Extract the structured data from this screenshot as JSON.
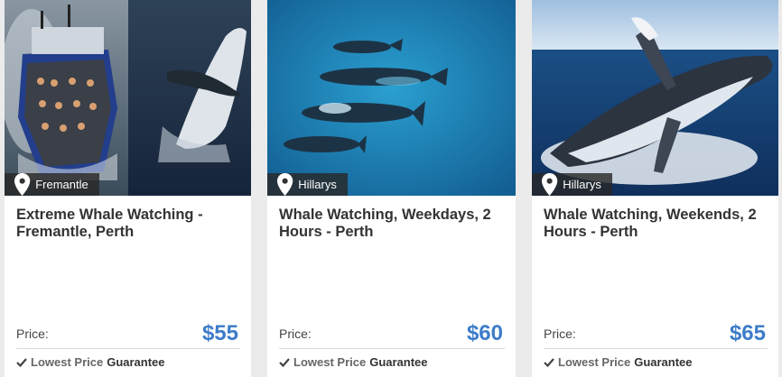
{
  "price_label": "Price:",
  "guarantee": {
    "part1": "Lowest Price",
    "part2": "Guarantee"
  },
  "colors": {
    "price": "#3d7cc9",
    "ocean": "#1f7fb3"
  },
  "cards": [
    {
      "location": "Fremantle",
      "title": "Extreme Whale Watching - Fremantle, Perth",
      "price": "$55"
    },
    {
      "location": "Hillarys",
      "title": "Whale Watching, Weekdays, 2 Hours - Perth",
      "price": "$60"
    },
    {
      "location": "Hillarys",
      "title": "Whale Watching, Weekends, 2 Hours - Perth",
      "price": "$65"
    }
  ]
}
